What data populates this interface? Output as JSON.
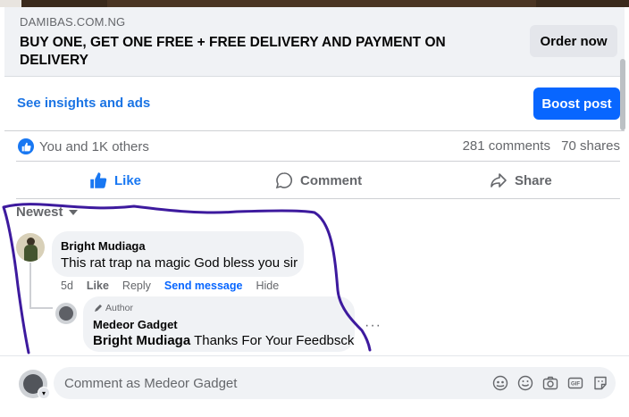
{
  "link_card": {
    "domain": "DAMIBAS.COM.NG",
    "title": "BUY ONE, GET ONE FREE + FREE DELIVERY AND PAYMENT ON DELIVERY",
    "cta_label": "Order now"
  },
  "post_actions": {
    "insights_label": "See insights and ads",
    "boost_label": "Boost post"
  },
  "reactions": {
    "summary": "You and 1K others",
    "comments_count": "281 comments",
    "shares_count": "70 shares"
  },
  "action_bar": {
    "like_label": "Like",
    "comment_label": "Comment",
    "share_label": "Share"
  },
  "comments_sort": "Newest",
  "comments": [
    {
      "author": "Bright Mudiaga",
      "text": "This rat trap na magic God bless you sir",
      "time": "5d",
      "actions": [
        "Like",
        "Reply",
        "Send message",
        "Hide"
      ],
      "reply": {
        "badge": "Author",
        "author": "Medeor Gadget",
        "mention": "Bright Mudiaga",
        "text": "Thanks For Your Feedbsck"
      }
    }
  ],
  "composer": {
    "placeholder": "Comment as Medeor Gadget"
  },
  "colors": {
    "accent": "#0866ff",
    "annotation": "#3d1a9e",
    "muted_text": "#65676b",
    "bubble": "#f0f2f5"
  },
  "icons": [
    "thumbs-up-icon",
    "comment-icon",
    "share-icon",
    "pencil-icon",
    "avatar-icon",
    "gif-icon",
    "camera-icon",
    "emoji-icon",
    "sticker-icon"
  ]
}
